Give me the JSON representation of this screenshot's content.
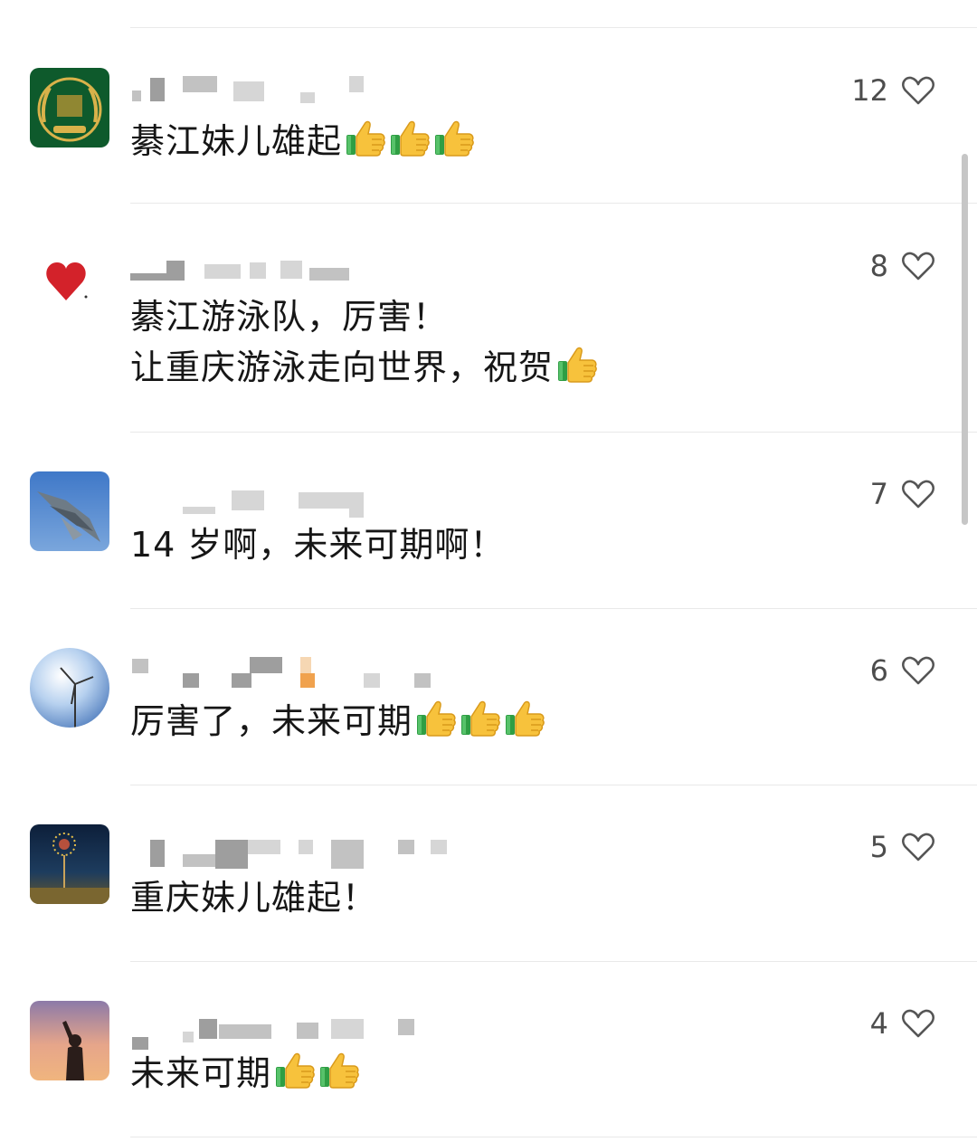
{
  "comments": [
    {
      "avatar_icon": "wheat-emblem-avatar-icon",
      "text_lines": [
        "綦江妹儿雄起"
      ],
      "thumbs": 3,
      "likes": "12"
    },
    {
      "avatar_icon": "red-heart-avatar-icon",
      "text_lines": [
        "綦江游泳队，厉害！",
        "让重庆游泳走向世界，祝贺"
      ],
      "thumbs": 1,
      "likes": "8"
    },
    {
      "avatar_icon": "fighter-jet-avatar-icon",
      "text_lines": [
        "14 岁啊，未来可期啊！"
      ],
      "thumbs": 0,
      "likes": "7"
    },
    {
      "avatar_icon": "wind-turbine-sky-avatar-icon",
      "text_lines": [
        "厉害了，未来可期"
      ],
      "thumbs": 3,
      "likes": "6"
    },
    {
      "avatar_icon": "fireworks-night-avatar-icon",
      "text_lines": [
        "重庆妹儿雄起！"
      ],
      "thumbs": 0,
      "likes": "5"
    },
    {
      "avatar_icon": "sunset-silhouette-avatar-icon",
      "text_lines": [
        "未来可期"
      ],
      "thumbs": 2,
      "likes": "4"
    }
  ],
  "colors": {
    "text": "#161616",
    "like_count": "#4d4d4d",
    "divider": "#e9e9e9",
    "heart_outline": "#555555"
  },
  "icons": {
    "like": "heart-outline-icon",
    "emoji": "thumbs-up-emoji-icon"
  }
}
